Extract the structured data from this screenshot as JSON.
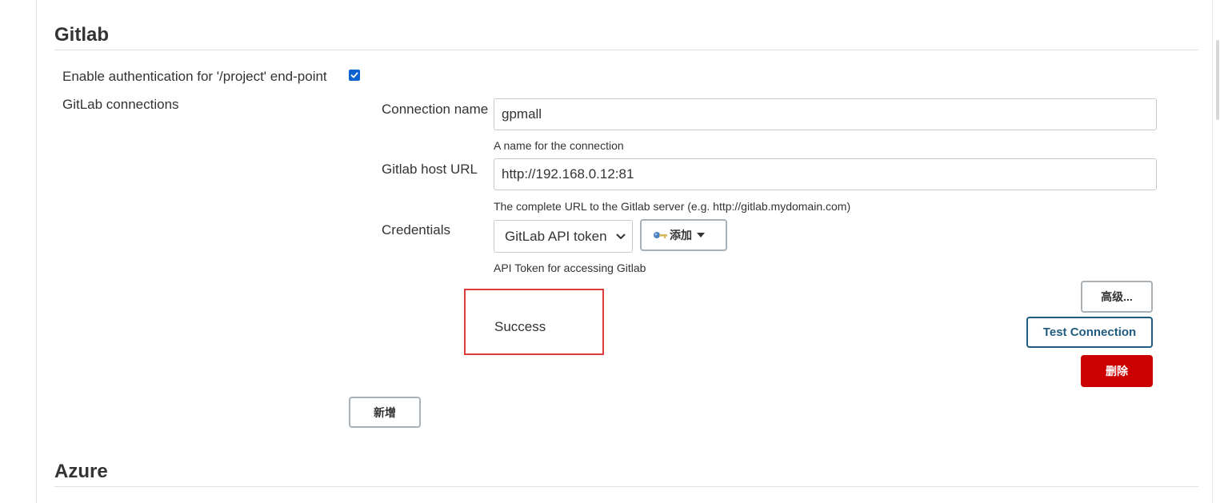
{
  "gitlab_section": {
    "title": "Gitlab",
    "enable_auth_label": "Enable authentication for '/project' end-point",
    "enable_auth_checked": true,
    "connections_label": "GitLab connections"
  },
  "connection": {
    "name_label": "Connection name",
    "name_value": "gpmall",
    "name_help": "A name for the connection",
    "host_label": "Gitlab host URL",
    "host_value": "http://192.168.0.12:81",
    "host_help": "The complete URL to the Gitlab server (e.g. http://gitlab.mydomain.com)",
    "credentials_label": "Credentials",
    "credentials_selected": "GitLab API token",
    "add_button_label": "添加",
    "credentials_help": "API Token for accessing Gitlab",
    "advanced_button_label": "高级...",
    "test_result": "Success",
    "test_button_label": "Test Connection",
    "delete_button_label": "删除"
  },
  "new_button_label": "新增",
  "azure_section": {
    "title": "Azure"
  },
  "colors": {
    "checkbox": "#0b63d1",
    "delete_button": "#cc0000",
    "test_button": "#1f5c80",
    "highlight_box": "#e03a3a"
  }
}
